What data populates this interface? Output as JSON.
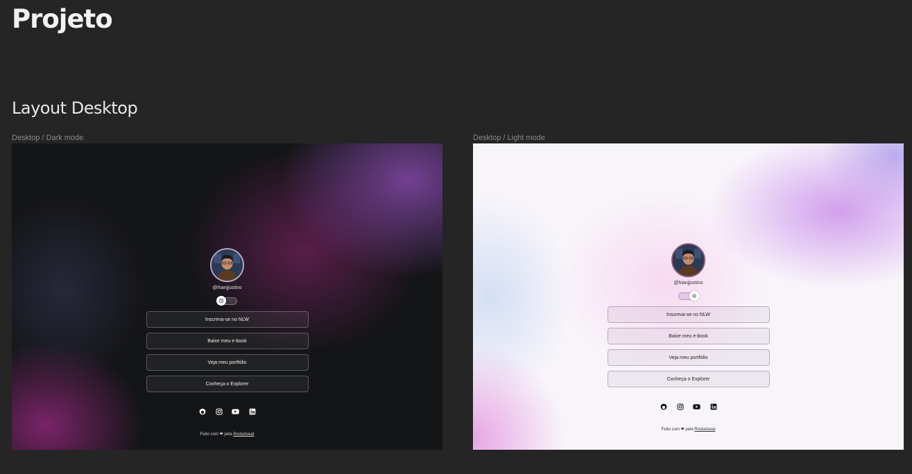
{
  "page": {
    "title": "Projeto",
    "section_title": "Layout Desktop"
  },
  "frames": [
    {
      "label": "Desktop / Dark mode",
      "theme": "dark",
      "handle": "@hianjjustino",
      "toggle_icon": "moon-icon",
      "links": [
        "Inscreva-se no NLW",
        "Baixe meu e-book",
        "Veja meu portfólio",
        "Conheça o Explorer"
      ],
      "socials": [
        "github-icon",
        "instagram-icon",
        "youtube-icon",
        "linkedin-icon"
      ],
      "footer": {
        "prefix": "Feito com",
        "heart": "❤",
        "middle": "pela",
        "link": "Rocketseat"
      }
    },
    {
      "label": "Desktop /  Light mode",
      "theme": "light",
      "handle": "@hianjjustino",
      "toggle_icon": "sun-icon",
      "links": [
        "Inscreva-se no NLW",
        "Baixe meu e-book",
        "Veja meu portfólio",
        "Conheça o Explorer"
      ],
      "socials": [
        "github-icon",
        "instagram-icon",
        "youtube-icon",
        "linkedin-icon"
      ],
      "footer": {
        "prefix": "Feito com",
        "heart": "❤",
        "middle": "pela",
        "link": "Rocketseat"
      }
    }
  ],
  "colors": {
    "canvas_bg": "#252525",
    "dark_bg": "#141517",
    "light_bg": "#f8f5fa",
    "accent_purple": "#8448a8"
  }
}
